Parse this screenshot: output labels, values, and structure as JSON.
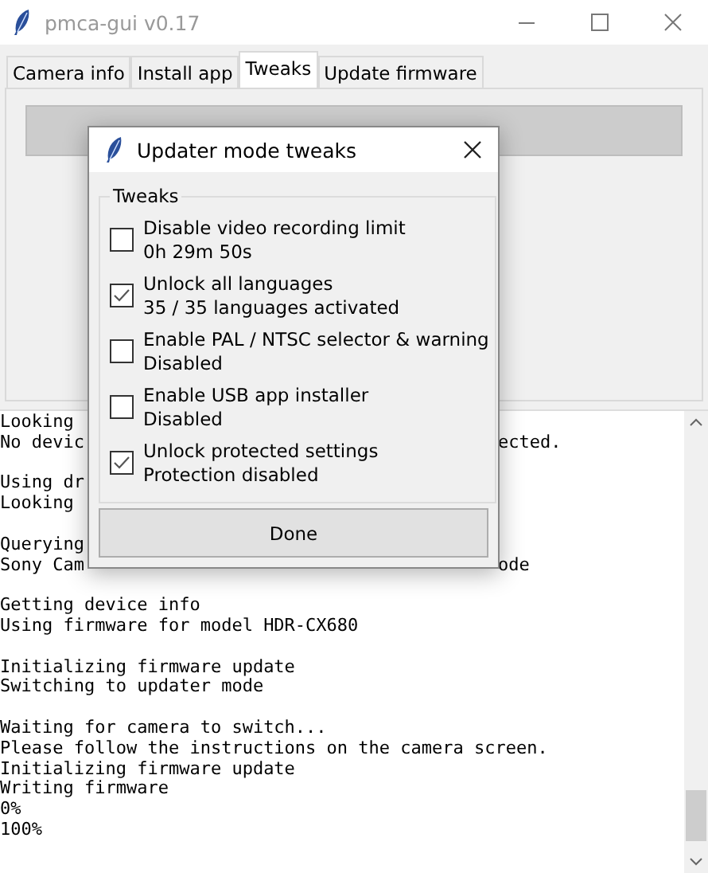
{
  "window": {
    "title": "pmca-gui v0.17"
  },
  "tabs": [
    {
      "label": "Camera info",
      "selected": false
    },
    {
      "label": "Install app",
      "selected": false
    },
    {
      "label": "Tweaks",
      "selected": true
    },
    {
      "label": "Update firmware",
      "selected": false
    }
  ],
  "log": {
    "blocks": [
      [
        {
          "text": "Looking"
        },
        {
          "text": "No devic",
          "tail": "ected."
        }
      ],
      [
        {
          "text": "Using dr"
        },
        {
          "text": "Looking"
        }
      ],
      [
        {
          "text": "Querying"
        },
        {
          "text": "Sony Cam",
          "tail": "ode"
        }
      ],
      [
        {
          "text": "Getting device info"
        },
        {
          "text": "Using firmware for model HDR-CX680"
        }
      ],
      [
        {
          "text": "Initializing firmware update"
        },
        {
          "text": "Switching to updater mode"
        }
      ],
      [
        {
          "text": "Waiting for camera to switch..."
        },
        {
          "text": "Please follow the instructions on the camera screen."
        },
        {
          "text": "Initializing firmware update"
        },
        {
          "text": "Writing firmware"
        },
        {
          "text": "0%"
        },
        {
          "text": "100%"
        }
      ]
    ]
  },
  "dialog": {
    "title": "Updater mode tweaks",
    "group": "Tweaks",
    "options": [
      {
        "label": "Disable video recording limit",
        "status": "0h 29m 50s",
        "checked": false
      },
      {
        "label": "Unlock all languages",
        "status": "35 / 35 languages activated",
        "checked": true
      },
      {
        "label": "Enable PAL / NTSC selector & warning",
        "status": "Disabled",
        "checked": false
      },
      {
        "label": "Enable USB app installer",
        "status": "Disabled",
        "checked": false
      },
      {
        "label": "Unlock protected settings",
        "status": "Protection disabled",
        "checked": true
      }
    ],
    "button": "Done"
  }
}
